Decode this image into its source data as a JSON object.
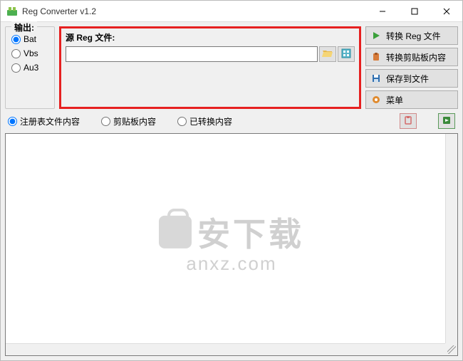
{
  "window": {
    "title": "Reg Converter v1.2"
  },
  "output": {
    "legend": "输出:",
    "options": [
      "Bat",
      "Vbs",
      "Au3"
    ],
    "selected": "Bat"
  },
  "source": {
    "label": "源 Reg 文件:",
    "value": ""
  },
  "actions": {
    "convert_reg": "转换 Reg 文件",
    "convert_clipboard": "转换剪贴板内容",
    "save_to_file": "保存到文件",
    "menu": "菜单"
  },
  "tabs": {
    "reg_content": "注册表文件内容",
    "clipboard_content": "剪贴板内容",
    "converted_content": "已转换内容",
    "selected": "reg_content"
  },
  "watermark": {
    "cn": "安下载",
    "en": "anxz.com"
  },
  "editor": {
    "text": ""
  }
}
